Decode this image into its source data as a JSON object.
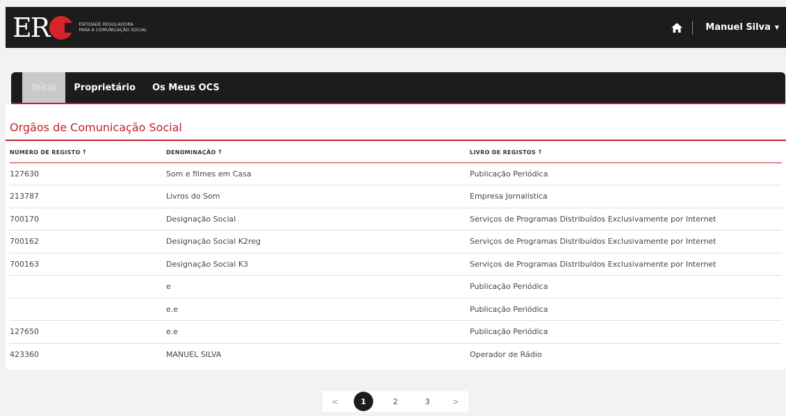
{
  "header": {
    "logo_mark": "ER",
    "logo_text_line1": "Entidade Reguladora",
    "logo_text_line2": "para a Comunicação Social",
    "user_name": "Manuel Silva"
  },
  "nav": {
    "items": [
      {
        "label": "Início",
        "active": true
      },
      {
        "label": "Proprietário",
        "active": false
      },
      {
        "label": "Os Meus OCS",
        "active": false
      }
    ]
  },
  "section": {
    "title": "Orgãos de Comunicação Social"
  },
  "table": {
    "columns": [
      "NÚMERO DE REGISTO",
      "DENOMINAÇÃO",
      "LIVRO DE REGISTOS"
    ],
    "sort_arrow": "🠕",
    "rows": [
      [
        "127630",
        "Som e filmes em Casa",
        "Publicação Periódica"
      ],
      [
        "213787",
        "Livros do Som",
        "Empresa Jornalística"
      ],
      [
        "700170",
        "Designação Social",
        "Serviços de Programas Distribuídos Exclusivamente por Internet"
      ],
      [
        "700162",
        "Designação Social K2reg",
        "Serviços de Programas Distribuídos Exclusivamente por Internet"
      ],
      [
        "700163",
        "Designação Social K3",
        "Serviços de Programas Distribuídos Exclusivamente por Internet"
      ],
      [
        "",
        "e",
        "Publicação Periódica"
      ],
      [
        "",
        "e.e",
        "Publicação Periódica"
      ],
      [
        "127650",
        "e.e",
        "Publicação Periódica"
      ],
      [
        "423360",
        "MANUEL SILVA",
        "Operador de Rádio"
      ]
    ]
  },
  "pagination": {
    "prev": "<",
    "next": ">",
    "pages": [
      "1",
      "2",
      "3"
    ],
    "current": "1"
  },
  "colors": {
    "accent": "#c0202a",
    "dark": "#1c1c1c"
  }
}
